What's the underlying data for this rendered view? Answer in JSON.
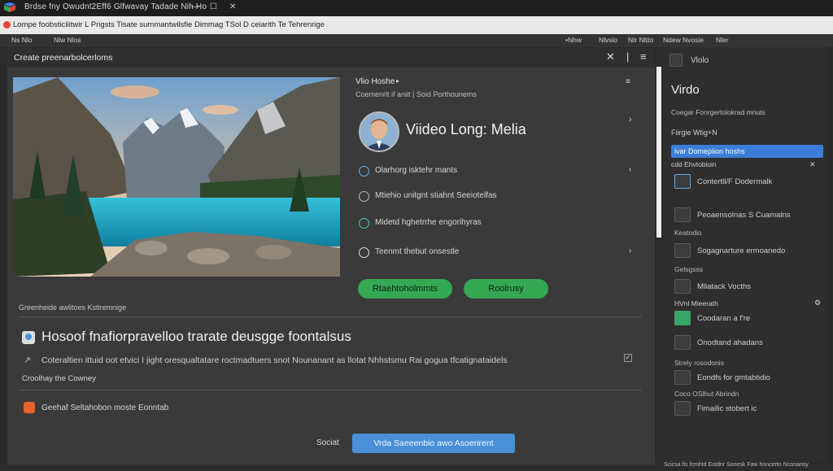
{
  "titlebar": {
    "text": "Brdse fny Owudnt2Eff6 Glfwavay  Tadade  Nih Ho",
    "controls": [
      "—",
      "☐",
      "✕"
    ]
  },
  "tabbar": {
    "text": "Lompe foobsticliitwir L Prigsts Tisate summantwilsfie Dimmag TSol D ceiarith  Te Tehrenrige"
  },
  "toolbar": {
    "items": [
      "Ns Nlo",
      "Nlw Nlos",
      "•Nhw",
      "Nlvsio",
      "Ntr Nltto",
      "Ndew Nvosie",
      "Nler"
    ]
  },
  "dialog": {
    "title": "Create  preenarbolcerloms",
    "header_buttons": [
      "✕",
      "|",
      "≡"
    ],
    "side_label": "Vlio Hoshe",
    "side_label_badge": "▸",
    "side_menu": "≡",
    "subtitle": "Coemenrlt if aniit | Soid Porthounems",
    "video_title": "Viideo Long: Melia",
    "rows": [
      {
        "label": "Olarhorg isktehr mants",
        "icon": "info-icon",
        "action": "‹"
      },
      {
        "label": "Mtiehio unitgnt stiahnt Seeiotelfas",
        "icon": "info-icon",
        "action": ""
      },
      {
        "label": "Midetd hghetrrhe engorihyras",
        "icon": "check-icon",
        "action": ""
      },
      {
        "label": "Teenmt thebut onsestle",
        "icon": "copyright-icon",
        "action": "›"
      }
    ],
    "btn_primary": "Rtaehtoholmmts",
    "btn_secondary": "Roolrusy",
    "section_label": "Greenheide awlitoes Kstiremnige",
    "headline": "Hosoof fnafiorpravelloo trarate deusgge foontalsus",
    "description": "Coteraltien ittuid oot etvici I jight oresqualtatare roctmadtuers snot Nounanant as llotat Nhhstsmu Rai gogua tfcatignataidels",
    "option1": "Croolhay the Cowney",
    "option2": "Geehaf Seltahobon moste Eonntab",
    "cancel_label": "Sociat",
    "submit_label": "Vrda Saeeenbio awo Asoerirent"
  },
  "sidebar": {
    "top_label": "Vlolo",
    "heading": "Virdo",
    "sub1": "Coegar Fonrgertolokrad mnuts",
    "sub2": "Fiirgie Wtig+N",
    "highlight": "ivar Domepiion hoshs",
    "sub3": "cdd Ehvtobioin",
    "items": [
      {
        "label": "Contertll/F Dodermalk",
        "icon": "monitor-icon"
      },
      {
        "label": "Peoaensolnas S Cuamalns",
        "icon": "monitor-icon"
      },
      {
        "label": "Sogagnarture ermoanedo",
        "icon": "document-icon"
      },
      {
        "label": "Mllatack Vocths",
        "icon": "video-icon"
      },
      {
        "label": "Coodaran a f're",
        "icon": "photos-icon"
      },
      {
        "label": "Onodtand ahadans",
        "icon": "dot-icon"
      },
      {
        "label": "Eondfs for gmtabtidio",
        "icon": "edit-icon"
      },
      {
        "label": "Fimailic stobert ic",
        "icon": "square-icon"
      }
    ],
    "section_a": "Keatodio",
    "section_b": "Gelsgsss",
    "section_c": "HVnl Mieerath",
    "section_d": "Strely rosodonis",
    "section_e": "Coco  OSlhut Abrindn",
    "status": "Scicsa fis fcmhtd   Eotdnr  Sonesk  Faw  hnncerto  Nconansy"
  },
  "colors": {
    "accent": "#34a853",
    "blue": "#4a90d9",
    "highlight": "#3b7dd8"
  }
}
